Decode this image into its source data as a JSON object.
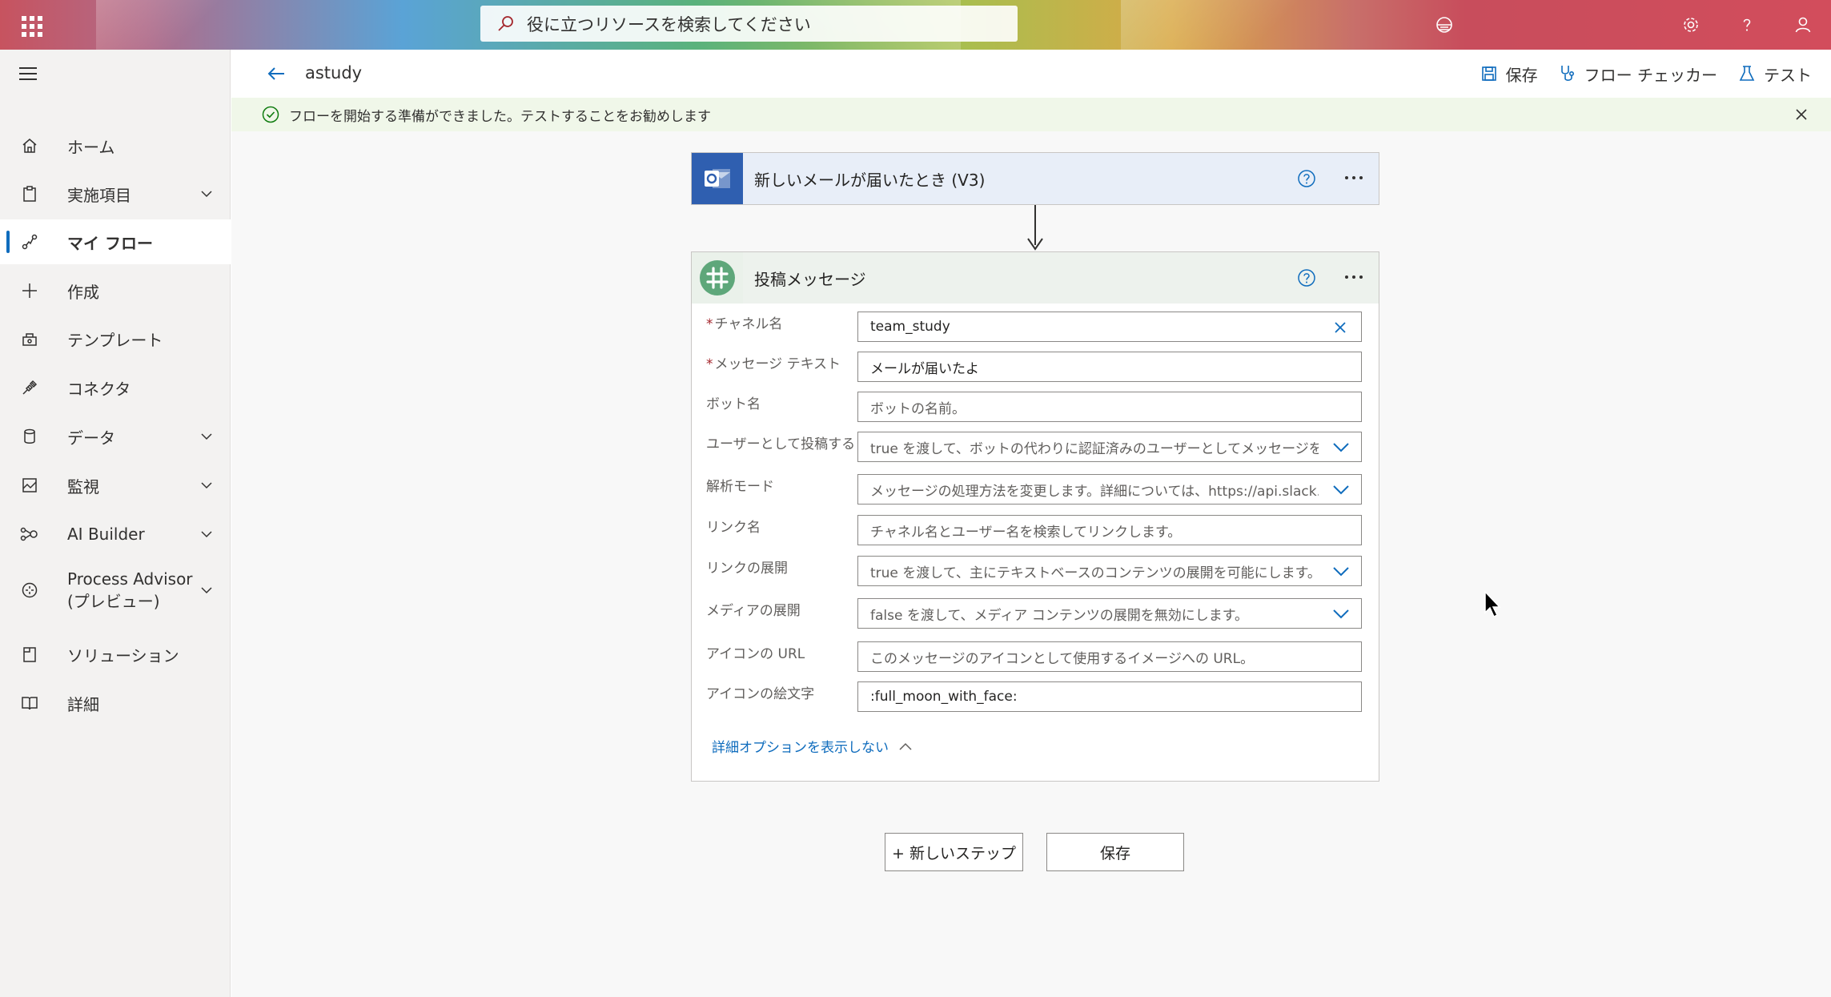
{
  "topbar": {
    "search_placeholder": "役に立つリソースを検索してください",
    "icons": [
      "app-launcher-icon",
      "search-icon",
      "environment-icon",
      "settings-icon",
      "help-icon",
      "account-icon"
    ]
  },
  "sidebar": {
    "items": [
      {
        "label": "ホーム",
        "icon": "home-icon",
        "expandable": false
      },
      {
        "label": "実施項目",
        "icon": "action-items-icon",
        "expandable": true
      },
      {
        "label": "マイ フロー",
        "icon": "flow-icon",
        "expandable": false,
        "active": true
      },
      {
        "label": "作成",
        "icon": "plus-icon",
        "expandable": false
      },
      {
        "label": "テンプレート",
        "icon": "template-icon",
        "expandable": false
      },
      {
        "label": "コネクタ",
        "icon": "connector-icon",
        "expandable": false
      },
      {
        "label": "データ",
        "icon": "database-icon",
        "expandable": true
      },
      {
        "label": "監視",
        "icon": "monitor-icon",
        "expandable": true
      },
      {
        "label": "AI Builder",
        "icon": "ai-builder-icon",
        "expandable": true
      },
      {
        "label": "Process Advisor\n(プレビュー)",
        "label_line1": "Process Advisor",
        "label_line2": "(プレビュー)",
        "icon": "process-advisor-icon",
        "expandable": true
      },
      {
        "label": "ソリューション",
        "icon": "solutions-icon",
        "expandable": false
      },
      {
        "label": "詳細",
        "icon": "learn-icon",
        "expandable": false
      }
    ]
  },
  "commandbar": {
    "flow_name": "astudy",
    "save_label": "保存",
    "checker_label": "フロー チェッカー",
    "test_label": "テスト"
  },
  "message": {
    "text": "フローを開始する準備ができました。テストすることをお勧めします"
  },
  "trigger": {
    "title": "新しいメールが届いたとき (V3)"
  },
  "action": {
    "title": "投稿メッセージ",
    "fields": [
      {
        "label": "チャネル名",
        "required": true,
        "value": "team_study",
        "placeholder": "",
        "control": "clear"
      },
      {
        "label": "メッセージ テキスト",
        "required": true,
        "value": "メールが届いたよ",
        "placeholder": "",
        "control": "none"
      },
      {
        "label": "ボット名",
        "required": false,
        "value": "",
        "placeholder": "ボットの名前。",
        "control": "none"
      },
      {
        "label": "ユーザーとして投稿する",
        "required": false,
        "value": "",
        "placeholder": "true を渡して、ボットの代わりに認証済みのユーザーとしてメッセージを投稿します。",
        "control": "dropdown"
      },
      {
        "label": "解析モード",
        "required": false,
        "value": "",
        "placeholder": "メッセージの処理方法を変更します。詳細については、https://api.slack.com/docs/formatting を参照してください。",
        "control": "dropdown"
      },
      {
        "label": "リンク名",
        "required": false,
        "value": "",
        "placeholder": "チャネル名とユーザー名を検索してリンクします。",
        "control": "none"
      },
      {
        "label": "リンクの展開",
        "required": false,
        "value": "",
        "placeholder": "true を渡して、主にテキストベースのコンテンツの展開を可能にします。",
        "control": "dropdown"
      },
      {
        "label": "メディアの展開",
        "required": false,
        "value": "",
        "placeholder": "false を渡して、メディア コンテンツの展開を無効にします。",
        "control": "dropdown"
      },
      {
        "label": "アイコンの URL",
        "required": false,
        "value": "",
        "placeholder": "このメッセージのアイコンとして使用するイメージへの URL。",
        "control": "none"
      },
      {
        "label": "アイコンの絵文字",
        "required": false,
        "value": ":full_moon_with_face:",
        "placeholder": "",
        "control": "none"
      }
    ],
    "advanced_toggle_label": "詳細オプションを表示しない"
  },
  "footer": {
    "new_step_label": "+ 新しいステップ",
    "save_label": "保存"
  },
  "colors": {
    "accent": "#0f6cbd",
    "trigger_icon_bg": "#2f5fb0",
    "success_bar": "#f0f7e9"
  }
}
